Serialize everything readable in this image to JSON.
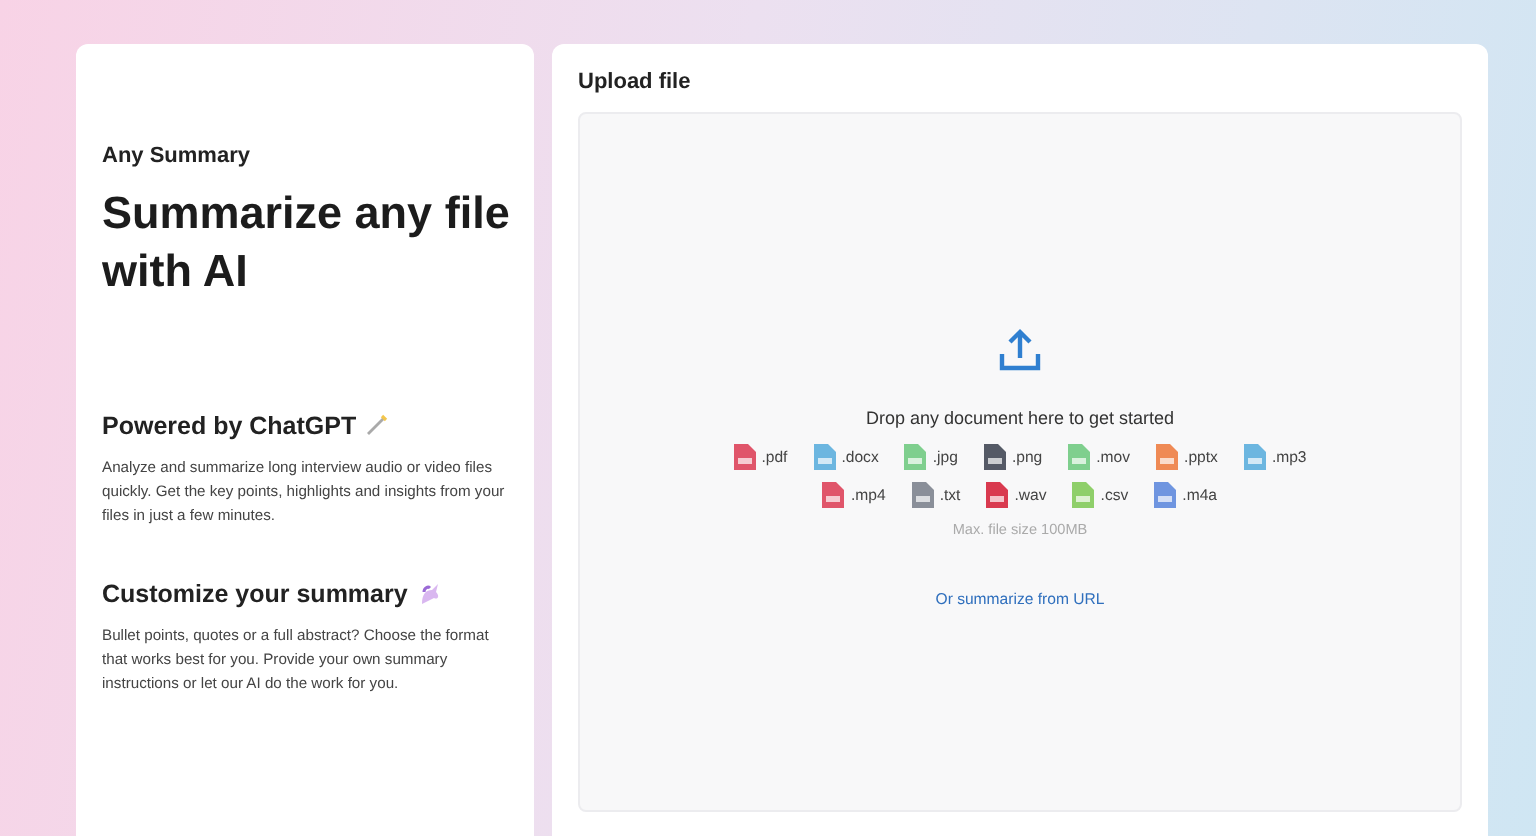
{
  "brand": "Any Summary",
  "headline": "Summarize any file with AI",
  "features": [
    {
      "title": "Powered by ChatGPT",
      "text": "Analyze and summarize long interview audio or video files quickly. Get the key points, highlights and insights from your files in just a few minutes."
    },
    {
      "title": "Customize your summary",
      "text": "Bullet points, quotes or a full abstract? Choose the format that works best for you. Provide your own summary instructions or let our AI do the work for you."
    }
  ],
  "upload": {
    "title": "Upload file",
    "prompt": "Drop any document here to get started",
    "file_types": [
      {
        "label": ".pdf",
        "color": "#e0556a"
      },
      {
        "label": ".docx",
        "color": "#6cb6e0"
      },
      {
        "label": ".jpg",
        "color": "#7fcf8e"
      },
      {
        "label": ".png",
        "color": "#555a66"
      },
      {
        "label": ".mov",
        "color": "#7fcf8e"
      },
      {
        "label": ".pptx",
        "color": "#ef8a55"
      },
      {
        "label": ".mp3",
        "color": "#6cb6e0"
      },
      {
        "label": ".mp4",
        "color": "#e0556a"
      },
      {
        "label": ".txt",
        "color": "#8a8f99"
      },
      {
        "label": ".wav",
        "color": "#d93a4f"
      },
      {
        "label": ".csv",
        "color": "#8fcf6a"
      },
      {
        "label": ".m4a",
        "color": "#6f95e0"
      }
    ],
    "max_size": "Max. file size 100MB",
    "url_link": "Or summarize from URL"
  }
}
